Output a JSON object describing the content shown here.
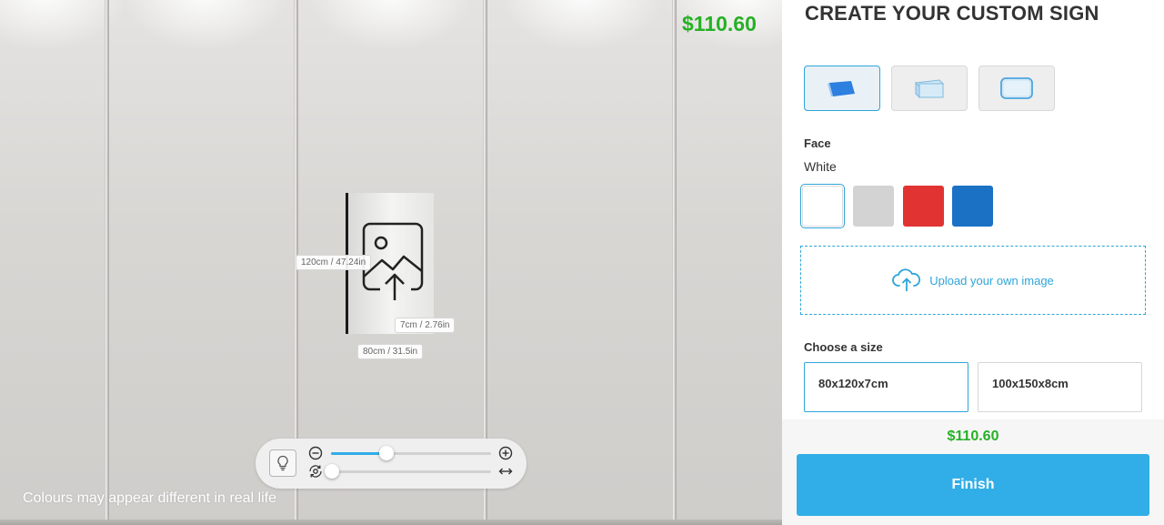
{
  "scene": {
    "price": "$110.60",
    "dimensions": {
      "height_label": "120cm / 47.24in",
      "depth_label": "7cm / 2.76in",
      "width_label": "80cm / 31.5in"
    },
    "toolbar": {
      "zoom_level": 0.34,
      "rotation_level": 0.0
    },
    "disclaimer": "Colours may appear different in real life"
  },
  "panel": {
    "title": "CREATE YOUR CUSTOM SIGN",
    "styles": [
      {
        "icon": "flat-panel-style-icon",
        "selected": true
      },
      {
        "icon": "box-frame-style-icon",
        "selected": false
      },
      {
        "icon": "rounded-frame-style-icon",
        "selected": false
      }
    ],
    "face": {
      "heading": "Face",
      "value": "White",
      "colors": [
        "#ffffff",
        "#d3d3d3",
        "#e23333",
        "#1b72c4"
      ]
    },
    "upload_label": "Upload your own image",
    "size": {
      "heading": "Choose a size",
      "options": [
        "80x120x7cm",
        "100x150x8cm"
      ]
    },
    "footer": {
      "price": "$110.60",
      "finish_label": "Finish"
    }
  },
  "colors": {
    "accent": "#31aee7",
    "price": "#27b026"
  }
}
